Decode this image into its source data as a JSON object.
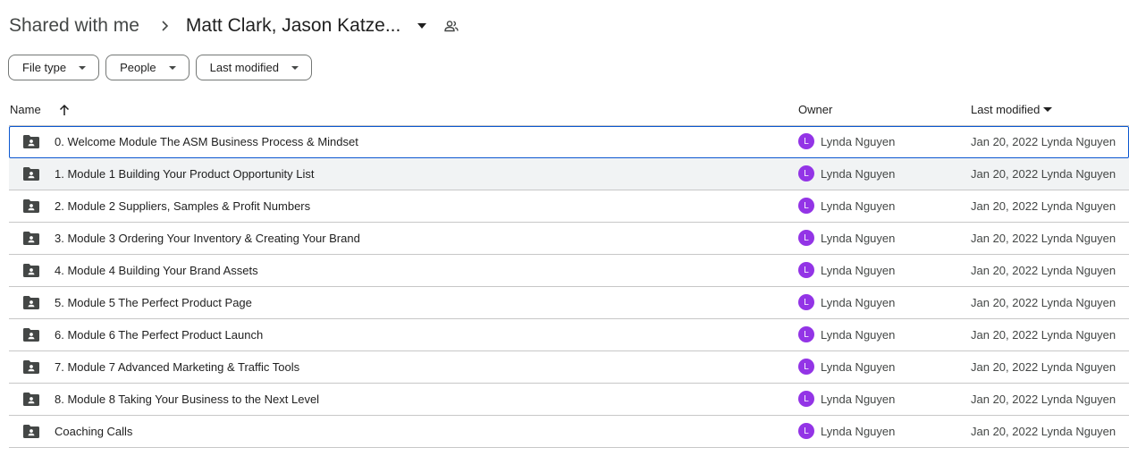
{
  "breadcrumb": {
    "root": "Shared with me",
    "current": "Matt Clark, Jason Katze..."
  },
  "filters": [
    {
      "label": "File type"
    },
    {
      "label": "People"
    },
    {
      "label": "Last modified"
    }
  ],
  "columns": {
    "name": "Name",
    "owner": "Owner",
    "last_modified": "Last modified"
  },
  "rows": [
    {
      "name": "0. Welcome Module The ASM Business Process & Mindset",
      "owner_initial": "L",
      "owner": "Lynda Nguyen",
      "modified": "Jan 20, 2022 Lynda Nguyen"
    },
    {
      "name": "1. Module 1 Building Your Product Opportunity List",
      "owner_initial": "L",
      "owner": "Lynda Nguyen",
      "modified": "Jan 20, 2022 Lynda Nguyen"
    },
    {
      "name": "2. Module 2 Suppliers, Samples & Profit Numbers",
      "owner_initial": "L",
      "owner": "Lynda Nguyen",
      "modified": "Jan 20, 2022 Lynda Nguyen"
    },
    {
      "name": "3. Module 3 Ordering Your Inventory & Creating Your Brand",
      "owner_initial": "L",
      "owner": "Lynda Nguyen",
      "modified": "Jan 20, 2022 Lynda Nguyen"
    },
    {
      "name": "4. Module 4 Building Your Brand Assets",
      "owner_initial": "L",
      "owner": "Lynda Nguyen",
      "modified": "Jan 20, 2022 Lynda Nguyen"
    },
    {
      "name": "5. Module 5 The Perfect Product Page",
      "owner_initial": "L",
      "owner": "Lynda Nguyen",
      "modified": "Jan 20, 2022 Lynda Nguyen"
    },
    {
      "name": "6. Module 6 The Perfect Product Launch",
      "owner_initial": "L",
      "owner": "Lynda Nguyen",
      "modified": "Jan 20, 2022 Lynda Nguyen"
    },
    {
      "name": "7. Module 7 Advanced Marketing & Traffic Tools",
      "owner_initial": "L",
      "owner": "Lynda Nguyen",
      "modified": "Jan 20, 2022 Lynda Nguyen"
    },
    {
      "name": "8. Module 8 Taking Your Business to the Next Level",
      "owner_initial": "L",
      "owner": "Lynda Nguyen",
      "modified": "Jan 20, 2022 Lynda Nguyen"
    },
    {
      "name": "Coaching Calls",
      "owner_initial": "L",
      "owner": "Lynda Nguyen",
      "modified": "Jan 20, 2022 Lynda Nguyen"
    }
  ],
  "icons": {
    "breadcrumb_separator": "chevron-right-icon",
    "breadcrumb_menu": "caret-down-icon",
    "shared_people": "people-icon",
    "filter_dropdown": "caret-down-icon",
    "sort_direction": "arrow-up-icon",
    "sort_dropdown": "caret-down-icon",
    "row_type": "shared-folder-icon"
  },
  "colors": {
    "avatar": "#9334e6",
    "selection_border": "#0b57d0",
    "hover_row": "#f1f3f4"
  }
}
